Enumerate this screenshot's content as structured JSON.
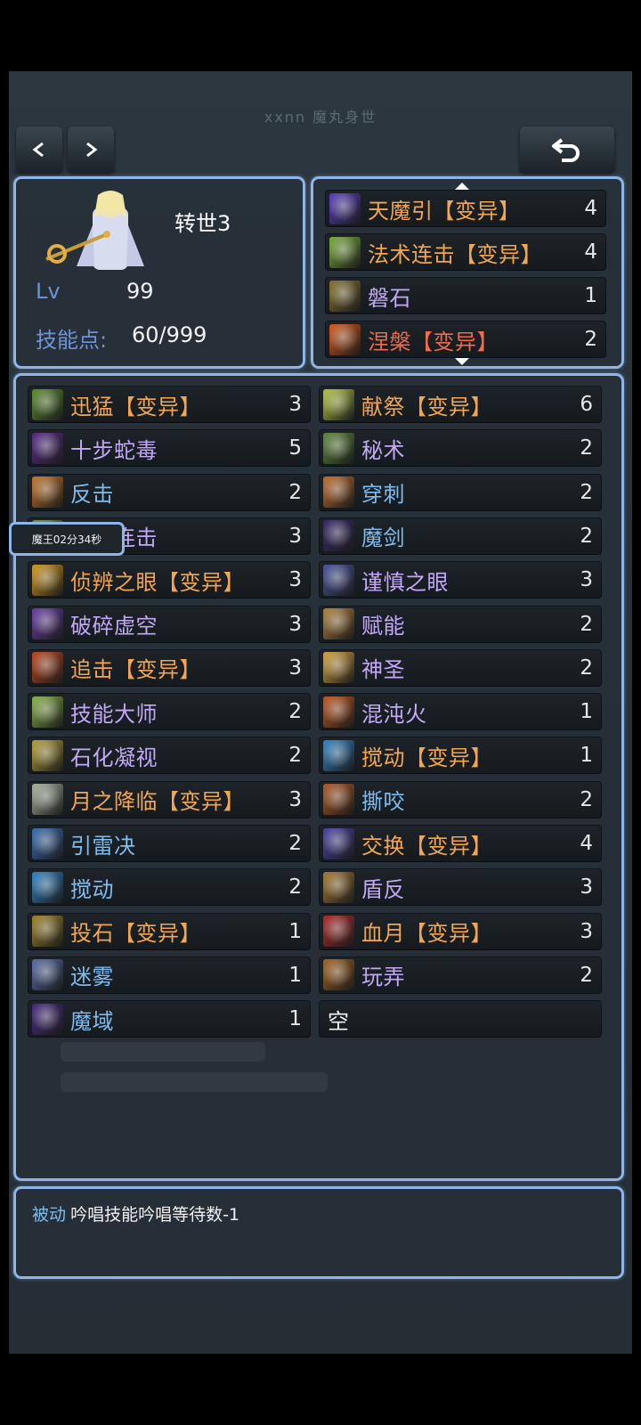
{
  "header": {
    "title": "xxnn 魔丸身世",
    "prev_label": "<",
    "next_label": ">",
    "back_icon": "undo-arrow-icon"
  },
  "hero": {
    "reincarnation": "转世3",
    "lv_label": "Lv",
    "lv_value": "99",
    "skill_points_label": "技能点:",
    "skill_points_value": "60/999"
  },
  "equipped": [
    {
      "name": "天魔引【变异】",
      "level": "4",
      "color": "orange",
      "icon": "slash-rune-icon",
      "icon_color": "#5b3fc0"
    },
    {
      "name": "法术连击【变异】",
      "level": "4",
      "color": "orange",
      "icon": "green-burst-icon",
      "icon_color": "#7cae3a"
    },
    {
      "name": "磐石",
      "level": "1",
      "color": "purple",
      "icon": "rock-icon",
      "icon_color": "#8a7430"
    },
    {
      "name": "涅槃【变异】",
      "level": "2",
      "color": "red",
      "icon": "phoenix-icon",
      "icon_color": "#d85a1c"
    }
  ],
  "skills_left": [
    {
      "name": "迅猛【变异】",
      "level": "3",
      "color": "orange",
      "icon": "swift-icon",
      "icon_color": "#5e8f2e"
    },
    {
      "name": "十步蛇毒",
      "level": "5",
      "color": "purple",
      "icon": "snake-icon",
      "icon_color": "#5a2c8c"
    },
    {
      "name": "反击",
      "level": "2",
      "color": "blue",
      "icon": "counter-icon",
      "icon_color": "#c9772b"
    },
    {
      "name": "法术连击",
      "level": "3",
      "color": "purple",
      "icon": "combo-icon",
      "icon_color": "#6f9e35"
    },
    {
      "name": "侦辨之眼【变异】",
      "level": "3",
      "color": "orange",
      "icon": "eye-icon",
      "icon_color": "#d49a1e"
    },
    {
      "name": "破碎虚空",
      "level": "3",
      "color": "purple",
      "icon": "void-icon",
      "icon_color": "#6a3fa8"
    },
    {
      "name": "追击【变异】",
      "level": "3",
      "color": "orange",
      "icon": "pursuit-icon",
      "icon_color": "#c0481f"
    },
    {
      "name": "技能大师",
      "level": "2",
      "color": "purple",
      "icon": "master-icon",
      "icon_color": "#8ab54a"
    },
    {
      "name": "石化凝视",
      "level": "2",
      "color": "purple",
      "icon": "gaze-icon",
      "icon_color": "#b8a436"
    },
    {
      "name": "月之降临【变异】",
      "level": "3",
      "color": "orange",
      "icon": "moon-icon",
      "icon_color": "#a7b59c"
    },
    {
      "name": "引雷决",
      "level": "2",
      "color": "blue",
      "icon": "thunder-icon",
      "icon_color": "#3a6fb8"
    },
    {
      "name": "搅动",
      "level": "2",
      "color": "blue",
      "icon": "wave-icon",
      "icon_color": "#2f86c9"
    },
    {
      "name": "投石【变异】",
      "level": "1",
      "color": "orange",
      "icon": "stone-throw-icon",
      "icon_color": "#a3862c"
    },
    {
      "name": "迷雾",
      "level": "1",
      "color": "blue",
      "icon": "mist-icon",
      "icon_color": "#5a6fa8"
    },
    {
      "name": "魔域",
      "level": "1",
      "color": "blue",
      "icon": "demon-realm-icon",
      "icon_color": "#4a2c86"
    }
  ],
  "skills_right": [
    {
      "name": "献祭【变异】",
      "level": "6",
      "color": "orange",
      "icon": "sacrifice-icon",
      "icon_color": "#b4c83a"
    },
    {
      "name": "秘术",
      "level": "2",
      "color": "purple",
      "icon": "arcane-icon",
      "icon_color": "#5f8a3a"
    },
    {
      "name": "穿刺",
      "level": "2",
      "color": "blue",
      "icon": "pierce-icon",
      "icon_color": "#c46d2a"
    },
    {
      "name": "魔剑",
      "level": "2",
      "color": "blue",
      "icon": "demon-sword-icon",
      "icon_color": "#3a2a6e"
    },
    {
      "name": "谨慎之眼",
      "level": "3",
      "color": "purple",
      "icon": "palm-eye-icon",
      "icon_color": "#4a55a0"
    },
    {
      "name": "赋能",
      "level": "2",
      "color": "purple",
      "icon": "empower-icon",
      "icon_color": "#b4823a"
    },
    {
      "name": "神圣",
      "level": "2",
      "color": "purple",
      "icon": "holy-icon",
      "icon_color": "#d7a53a"
    },
    {
      "name": "混沌火",
      "level": "1",
      "color": "purple",
      "icon": "chaos-fire-icon",
      "icon_color": "#c4581e"
    },
    {
      "name": "搅动【变异】",
      "level": "1",
      "color": "orange",
      "icon": "wave-icon",
      "icon_color": "#2f86c9"
    },
    {
      "name": "撕咬",
      "level": "2",
      "color": "blue",
      "icon": "bite-icon",
      "icon_color": "#b25a24"
    },
    {
      "name": "交换【变异】",
      "level": "4",
      "color": "orange",
      "icon": "swap-icon",
      "icon_color": "#4a45a8"
    },
    {
      "name": "盾反",
      "level": "3",
      "color": "purple",
      "icon": "shield-icon",
      "icon_color": "#a8782c"
    },
    {
      "name": "血月【变异】",
      "level": "3",
      "color": "orange",
      "icon": "blood-moon-icon",
      "icon_color": "#b42a2a"
    },
    {
      "name": "玩弄",
      "level": "2",
      "color": "purple",
      "icon": "trick-icon",
      "icon_color": "#a8641e"
    },
    {
      "name": "空",
      "level": "",
      "color": "white",
      "icon": "",
      "icon_color": ""
    }
  ],
  "tooltip": {
    "text": "魔王02分34秒"
  },
  "passive": {
    "label": "被动",
    "text": "吟唱技能吟唱等待数-1"
  }
}
